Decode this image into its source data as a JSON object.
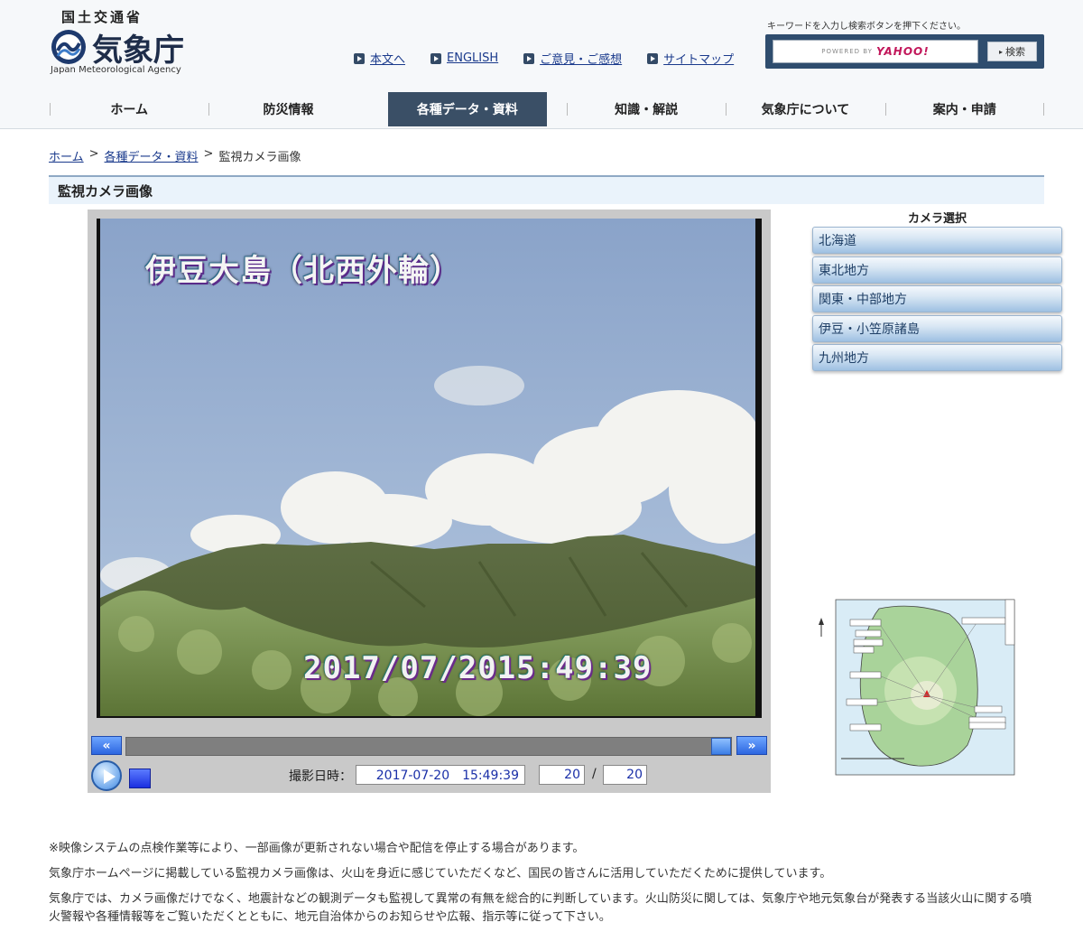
{
  "header": {
    "ministry": "国土交通省",
    "agency_name": "気象庁",
    "agency_en": "Japan Meteorological Agency",
    "util_links": [
      "本文へ",
      "ENGLISH",
      "ご意見・ご感想",
      "サイトマップ"
    ],
    "search": {
      "hint": "キーワードを入力し検索ボタンを押下ください。",
      "powered_by": "POWERED BY",
      "brand": "YAHOO!",
      "button_label": "検索"
    }
  },
  "nav": {
    "items": [
      "ホーム",
      "防災情報",
      "各種データ・資料",
      "知識・解説",
      "気象庁について",
      "案内・申請"
    ],
    "active_index": 2,
    "active_color": "#3a4f66"
  },
  "breadcrumb": {
    "home": "ホーム",
    "data": "各種データ・資料",
    "current": "監視カメラ画像",
    "sep": ">"
  },
  "page_title": "監視カメラ画像",
  "viewer": {
    "camera_label": "伊豆大島（北西外輪）",
    "timestamp_overlay": "2017/07/2015:49:39",
    "prev_icon": "double-left-arrow-icon",
    "next_icon": "double-right-arrow-icon",
    "slider_position": 1.0,
    "shot_label": "撮影日時：",
    "shot_datetime": "2017-07-20　15:49:39",
    "frame_current": "20",
    "frame_sep": "/",
    "frame_total": "20"
  },
  "camera_select": {
    "title": "カメラ選択",
    "regions": [
      "北海道",
      "東北地方",
      "関東・中部地方",
      "伊豆・小笠原諸島",
      "九州地方"
    ]
  },
  "notices": [
    "※映像システムの点検作業等により、一部画像が更新されない場合や配信を停止する場合があります。",
    "気象庁ホームページに掲載している監視カメラ画像は、火山を身近に感じていただくなど、国民の皆さんに活用していただくために提供しています。",
    "気象庁では、カメラ画像だけでなく、地震計などの観測データも監視して異常の有無を総合的に判断しています。火山防災に関しては、気象庁や地元気象台が発表する当該火山に関する噴火警報や各種情報等をご覧いただくとともに、地元自治体からのお知らせや広報、指示等に従って下さい。"
  ]
}
